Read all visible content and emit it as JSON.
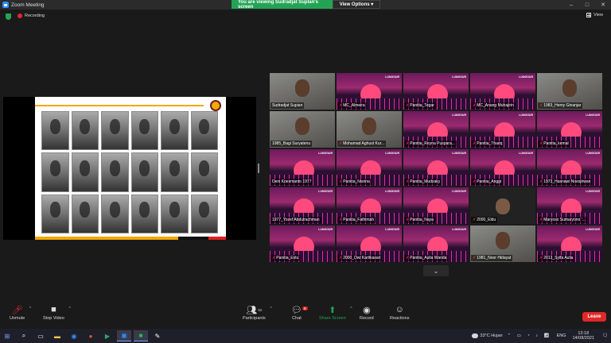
{
  "window": {
    "title": "Zoom Meeting"
  },
  "banner": {
    "message": "You are viewing Sudradjat Suplan's screen",
    "view_options": "View Options"
  },
  "status": {
    "recording": "Recording"
  },
  "view": {
    "label": "View"
  },
  "gallery": {
    "tiles": [
      {
        "name": "Sudradjat Supian",
        "type": "cam",
        "muted": false,
        "active": true
      },
      {
        "name": "MC_Almeira",
        "type": "logo",
        "muted": true
      },
      {
        "name": "Panitia_Tegar",
        "type": "logo",
        "muted": true
      },
      {
        "name": "MC_Anang Muhajirin",
        "type": "logo",
        "muted": true
      },
      {
        "name": "1983_Hemy Ginanjar",
        "type": "cam",
        "muted": true
      },
      {
        "name": "1985_Bagi Suryatenu",
        "type": "cam",
        "muted": false
      },
      {
        "name": "Mohamad Aghust Kur...",
        "type": "cam",
        "muted": true
      },
      {
        "name": "Panitia_Reyna Puspara...",
        "type": "logo",
        "muted": true
      },
      {
        "name": "Panitia_Thariq",
        "type": "logo",
        "muted": true
      },
      {
        "name": "Panitia_kemal",
        "type": "logo",
        "muted": true
      },
      {
        "name": "Deni Koesmanto 1977",
        "type": "logo",
        "muted": false
      },
      {
        "name": "Panitia_Nisrina",
        "type": "logo",
        "muted": true
      },
      {
        "name": "Panitia_Mudzaky",
        "type": "logo",
        "muted": true
      },
      {
        "name": "Panitia_Anggi",
        "type": "logo",
        "muted": true
      },
      {
        "name": "1973_Hasnawi Noesjirwan",
        "type": "logo",
        "muted": true
      },
      {
        "name": "1977_Yozef Abdulrachman",
        "type": "logo",
        "muted": false
      },
      {
        "name": "Panitia_Fathimah",
        "type": "logo",
        "muted": true
      },
      {
        "name": "Panitia_Naya",
        "type": "logo",
        "muted": true
      },
      {
        "name": "2000_Eldu",
        "type": "dark",
        "muted": true
      },
      {
        "name": "Maryoso Sumaryono '...",
        "type": "logo",
        "muted": true
      },
      {
        "name": "Panitia_Estu",
        "type": "logo",
        "muted": true
      },
      {
        "name": "2000_Dwi Kartikasari",
        "type": "logo",
        "muted": true
      },
      {
        "name": "Panitia_Aulia Wanda",
        "type": "logo",
        "muted": true
      },
      {
        "name": "1981_Noor Hidayat",
        "type": "cam",
        "muted": true
      },
      {
        "name": "2013_Syifa Aulia",
        "type": "logo",
        "muted": true
      }
    ],
    "brand_text": "LUNGGUR"
  },
  "toolbar": {
    "unmute": "Unmute",
    "stop_video": "Stop Video",
    "participants": "Participants",
    "participants_count": "92",
    "chat": "Chat",
    "chat_badge": "6",
    "share_screen": "Share Screen",
    "record": "Record",
    "reactions": "Reactions",
    "leave": "Leave"
  },
  "taskbar": {
    "weather": "33°C  Hujan",
    "lang": "ENG",
    "time": "13:18",
    "date": "14/08/2021"
  },
  "colors": {
    "share_green": "#23a455",
    "leave_red": "#e02828",
    "zoom_blue": "#2d8cff",
    "active_speaker": "#e6d54a"
  }
}
